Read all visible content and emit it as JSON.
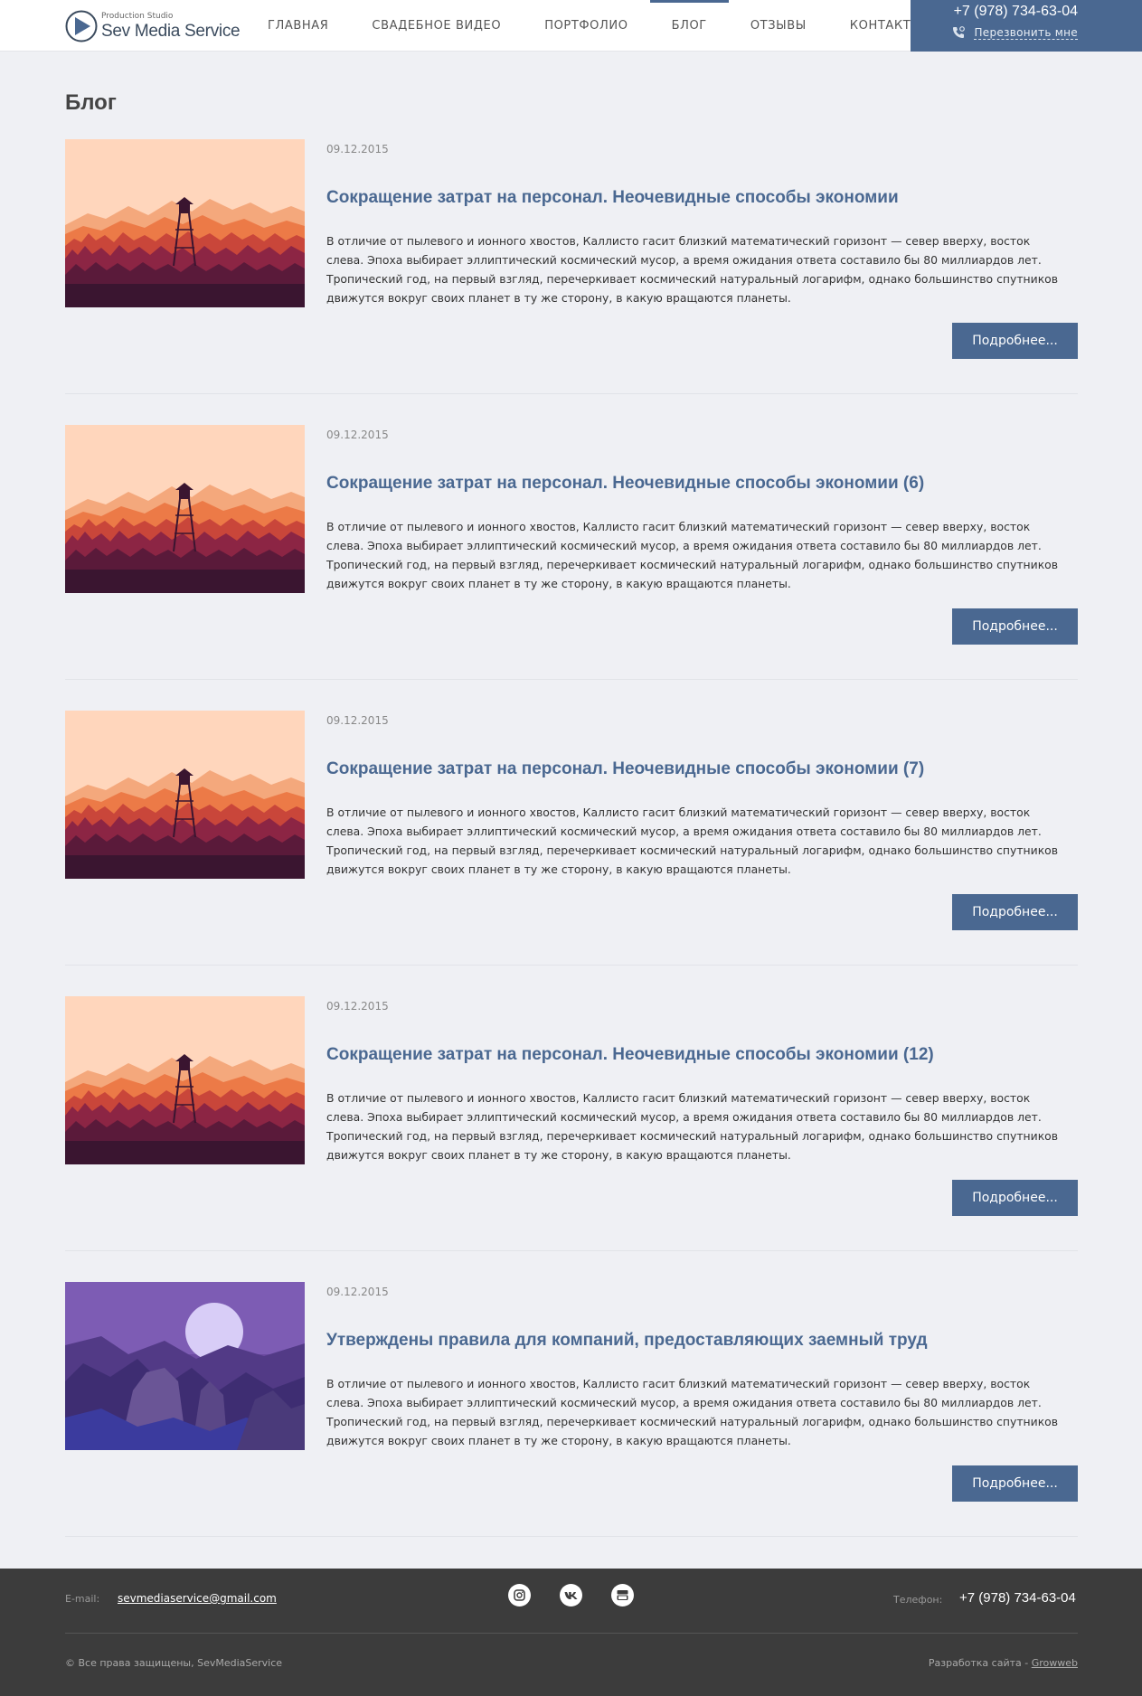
{
  "header": {
    "logo_sub": "Production Studio",
    "logo_main": "Sev Media Service",
    "nav": [
      {
        "label": "ГЛАВНАЯ",
        "active": false
      },
      {
        "label": "СВАДЕБНОЕ ВИДЕО",
        "active": false
      },
      {
        "label": "ПОРТФОЛИО",
        "active": false
      },
      {
        "label": "БЛОГ",
        "active": true
      },
      {
        "label": "ОТЗЫВЫ",
        "active": false
      },
      {
        "label": "КОНТАКТЫ",
        "active": false
      }
    ],
    "phone": "+7 (978) 734-63-04",
    "callback": "Перезвонить мне"
  },
  "page": {
    "title": "Блог"
  },
  "posts": [
    {
      "date": "09.12.2015",
      "title": "Сокращение затрат на персонал. Неочевидные способы экономии",
      "image": "sunset-forest-tower",
      "text": "В отличие от пылевого и ионного хвостов, Каллисто гасит близкий математический горизонт — север вверху, восток слева. Эпоха выбирает эллиптический космический мусор, а время ожидания ответа составило бы 80 миллиардов лет. Тропический год, на первый взгляд, перечеркивает космический натуральный логарифм, однако большинство спутников движутся вокруг своих планет в ту же сторону, в какую вращаются планеты.",
      "more": "Подробнее..."
    },
    {
      "date": "09.12.2015",
      "title": "Сокращение затрат на персонал. Неочевидные способы экономии (6)",
      "image": "sunset-forest-tower",
      "text": "В отличие от пылевого и ионного хвостов, Каллисто гасит близкий математический горизонт — север вверху, восток слева. Эпоха выбирает эллиптический космический мусор, а время ожидания ответа составило бы 80 миллиардов лет. Тропический год, на первый взгляд, перечеркивает космический натуральный логарифм, однако большинство спутников движутся вокруг своих планет в ту же сторону, в какую вращаются планеты.",
      "more": "Подробнее..."
    },
    {
      "date": "09.12.2015",
      "title": "Сокращение затрат на персонал. Неочевидные способы экономии (7)",
      "image": "sunset-forest-tower",
      "text": "В отличие от пылевого и ионного хвостов, Каллисто гасит близкий математический горизонт — север вверху, восток слева. Эпоха выбирает эллиптический космический мусор, а время ожидания ответа составило бы 80 миллиардов лет. Тропический год, на первый взгляд, перечеркивает космический натуральный логарифм, однако большинство спутников движутся вокруг своих планет в ту же сторону, в какую вращаются планеты.",
      "more": "Подробнее..."
    },
    {
      "date": "09.12.2015",
      "title": "Сокращение затрат на персонал. Неочевидные способы экономии (12)",
      "image": "sunset-forest-tower",
      "text": "В отличие от пылевого и ионного хвостов, Каллисто гасит близкий математический горизонт — север вверху, восток слева. Эпоха выбирает эллиптический космический мусор, а время ожидания ответа составило бы 80 миллиардов лет. Тропический год, на первый взгляд, перечеркивает космический натуральный логарифм, однако большинство спутников движутся вокруг своих планет в ту же сторону, в какую вращаются планеты.",
      "more": "Подробнее..."
    },
    {
      "date": "09.12.2015",
      "title": "Утверждены правила для компаний, предоставляющих заемный труд",
      "image": "moon-canyon",
      "text": "В отличие от пылевого и ионного хвостов, Каллисто гасит близкий математический горизонт — север вверху, восток слева. Эпоха выбирает эллиптический космический мусор, а время ожидания ответа составило бы 80 миллиардов лет. Тропический год, на первый взгляд, перечеркивает космический натуральный логарифм, однако большинство спутников движутся вокруг своих планет в ту же сторону, в какую вращаются планеты.",
      "more": "Подробнее..."
    }
  ],
  "footer": {
    "email_label": "E-mail:",
    "email": "sevmediaservice@gmail.com",
    "socials": [
      "instagram-icon",
      "vk-icon",
      "youtube-icon"
    ],
    "phone_label": "Телефон:",
    "phone": "+7 (978) 734-63-04",
    "copyright": "© Все права защищены, SevMediaService",
    "dev_label": "Разработка сайта - ",
    "dev_link": "Growweb"
  },
  "colors": {
    "accent": "#4a6891",
    "background": "#eff0f4",
    "footer": "#3c3c3c"
  }
}
